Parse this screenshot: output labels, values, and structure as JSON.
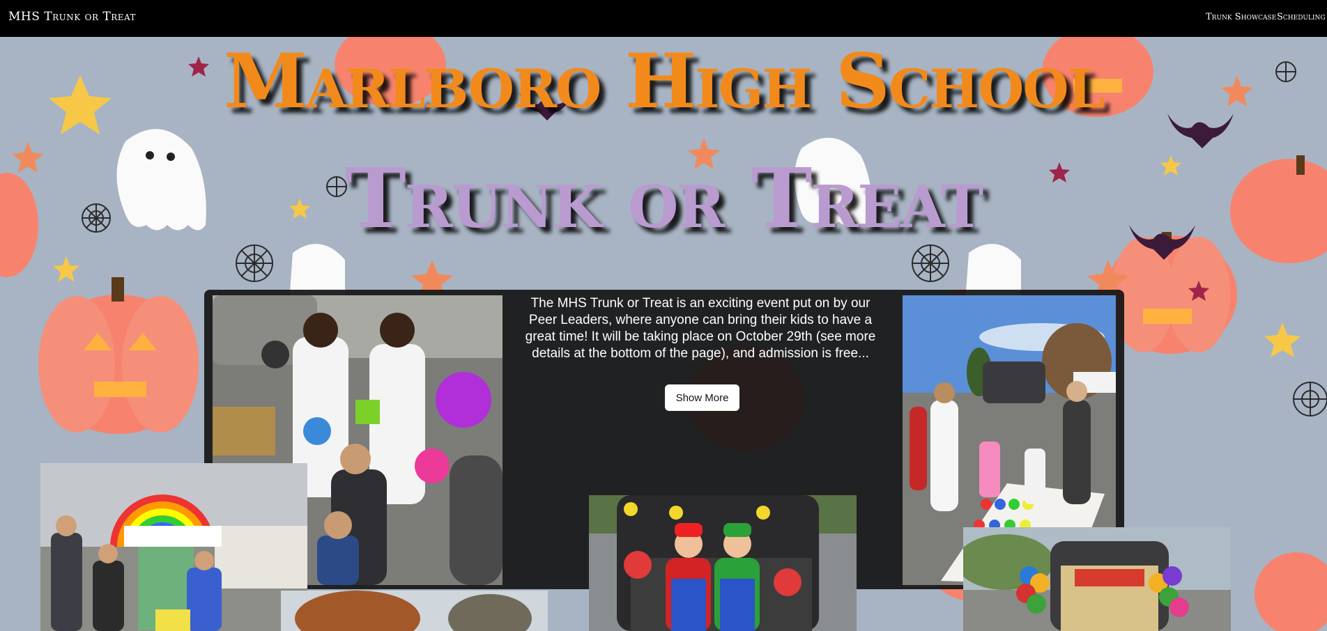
{
  "navbar": {
    "brand": "MHS Trunk or Treat",
    "links": [
      "Trunk Showcase",
      "Scheduling"
    ]
  },
  "hero": {
    "line1": "Marlboro High School",
    "line2": "Trunk or Treat"
  },
  "intro": {
    "text": "The MHS Trunk or Treat is an exciting event put on by our Peer Leaders, where anyone can bring their kids to have a great time! It will be taking place on October 29th (see more details at the bottom of the page), and admission is free...",
    "button": "Show More"
  },
  "colors": {
    "navbar_bg": "#000000",
    "page_bg": "#a8b4c3",
    "title_orange": "#f28a1b",
    "title_purple": "#b99bd0",
    "panel_bg": "#161616"
  },
  "decor_icons": [
    "pumpkin-icon",
    "ghost-icon",
    "star-icon",
    "bat-icon",
    "spiderweb-icon"
  ],
  "photos": [
    "photo-lab-coat-kids",
    "photo-rainbow-trunk",
    "photo-mario-luigi-trunk",
    "photo-twister-trunk",
    "photo-balloon-trunk",
    "photo-autumn-trees"
  ]
}
